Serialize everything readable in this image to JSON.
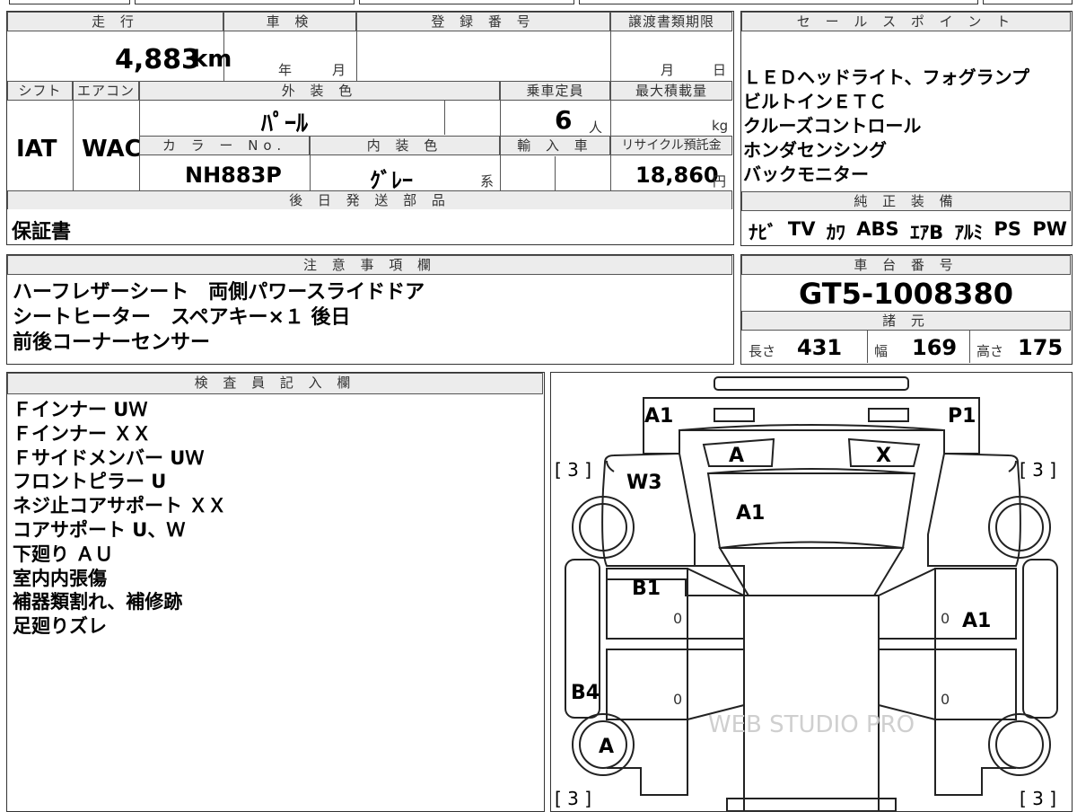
{
  "vehicle": {
    "mileage_label": "走 行",
    "mileage_value": "4,883",
    "mileage_unit": "km",
    "inspection_label": "車 検",
    "inspection_year_unit": "年",
    "inspection_month_unit": "月",
    "registration_label": "登 録 番 号",
    "transfer_deadline_label": "譲渡書類期限",
    "transfer_month_unit": "月",
    "transfer_day_unit": "日",
    "shift_label": "シフト",
    "shift_value": "IAT",
    "aircon_label": "エアコン",
    "aircon_value": "WAC",
    "exterior_color_label": "外 装 色",
    "exterior_color_value": "ﾊﾟｰﾙ",
    "capacity_label": "乗車定員",
    "capacity_value": "6",
    "capacity_unit": "人",
    "max_load_label": "最大積載量",
    "max_load_unit": "kg",
    "color_no_label": "カ ラ ー No.",
    "color_no_value": "NH883P",
    "interior_color_label": "内 装 色",
    "interior_color_value": "ｸﾞﾚｰ",
    "interior_color_suffix": "系",
    "import_label": "輸 入 車",
    "recycle_label": "リサイクル預託金",
    "recycle_value": "18,860",
    "recycle_unit": "円"
  },
  "later_parts": {
    "label": "後 日 発 送 部 品",
    "value": "保証書"
  },
  "sales_points": {
    "label": "セ ー ル ス ポ イ ン ト",
    "lines": [
      "ＬＥＤヘッドライト、フォグランプ",
      "ビルトインＥＴＣ",
      "クルーズコントロール",
      "ホンダセンシング",
      "バックモニター"
    ]
  },
  "equipment": {
    "label": "純 正 装 備",
    "items": [
      "ﾅﾋﾞ",
      "TV",
      "ｶﾜ",
      "ABS",
      "ｴｱB",
      "ｱﾙﾐ",
      "PS",
      "PW"
    ]
  },
  "notes": {
    "label": "注 意 事 項 欄",
    "lines": [
      "ハーフレザーシート　両側パワースライドドア",
      "シートヒーター　スペアキー×１ 後日",
      "前後コーナーセンサー"
    ]
  },
  "chassis": {
    "label": "車 台 番 号",
    "value": "GT5-1008380"
  },
  "specs": {
    "label": "諸 元",
    "length_label": "長さ",
    "length_value": "431",
    "width_label": "幅",
    "width_value": "169",
    "height_label": "高さ",
    "height_value": "175"
  },
  "inspector": {
    "label": "検 査 員 記 入 欄",
    "lines": [
      "Ｆインナー UＷ",
      "Ｆインナー ＸＸ",
      "Ｆサイドメンバー UＷ",
      "フロントピラー U",
      "ネジ止コアサポート ＸＸ",
      "コアサポート U、Ｗ",
      "下廻り ＡＵ",
      "室内内張傷",
      "補器類割れ、補修跡",
      "足廻りズレ"
    ]
  },
  "diagram": {
    "marks": {
      "front_left": "A1",
      "front_right": "P1",
      "windshield_left": "A",
      "windshield_right": "X",
      "fender_left": "W3",
      "hood": "A1",
      "front_door_left": "B1",
      "front_door_right": "A1",
      "rear_door_left": "B4",
      "rear_wheel_left": "A"
    },
    "tire_marks": [
      "[ 3 ]",
      "[ 3 ]",
      "[ 3 ]",
      "[ 3 ]"
    ],
    "zero": "0",
    "watermark": "WEB STUDIO PRO"
  }
}
